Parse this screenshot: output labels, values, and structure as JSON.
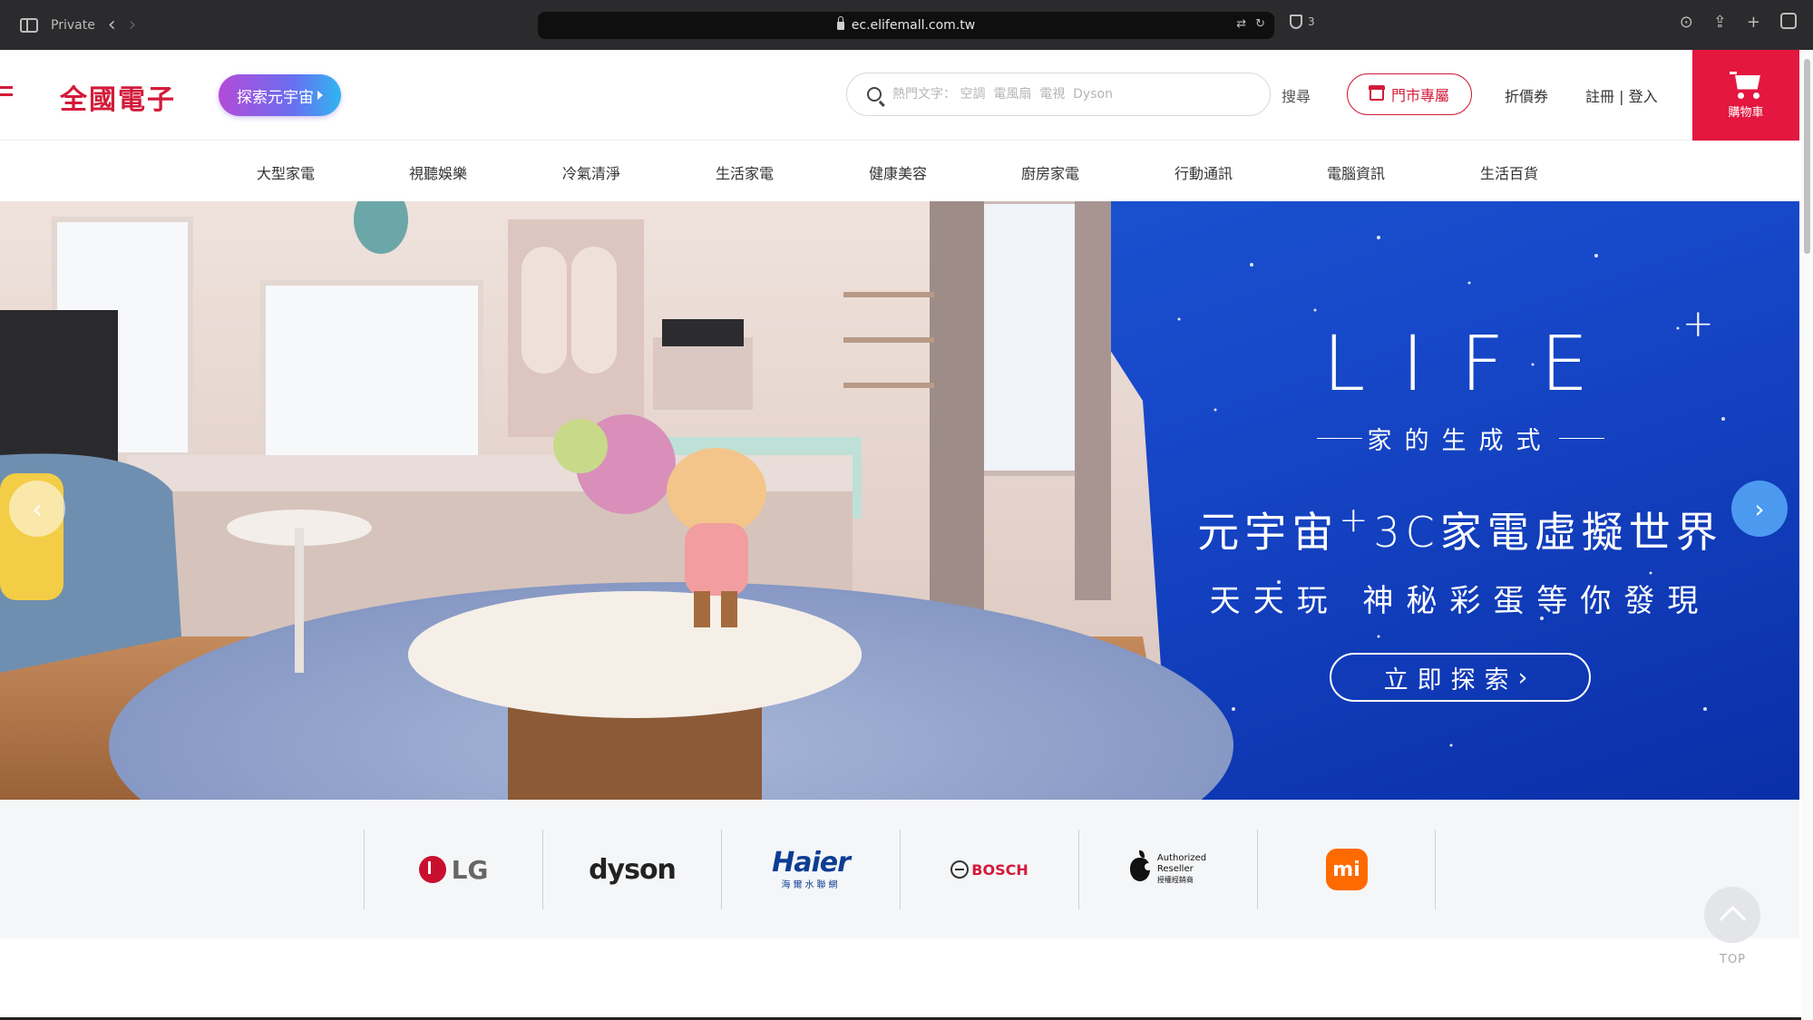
{
  "browser": {
    "mode_label": "Private",
    "url": "ec.elifemall.com.tw",
    "shield_count": "3"
  },
  "header": {
    "logo_text": "全國電子",
    "explore_label": "探索元宇宙",
    "search_placeholder": "熱門文字： 空調  電風扇  電視  Dyson",
    "search_label": "搜尋",
    "store_label": "門市專屬",
    "coupon_label": "折價券",
    "login_label": "註冊 | 登入",
    "cart_label": "購物車",
    "brand_color": "#d21b3a"
  },
  "categories": [
    "大型家電",
    "視聽娛樂",
    "冷氣清淨",
    "生活家電",
    "健康美容",
    "廚房家電",
    "行動通訊",
    "電腦資訊",
    "生活百貨"
  ],
  "hero": {
    "logo_text": "LIFE",
    "logo_sup": "+",
    "tagline": "家的生成式",
    "headline_a": "元宇宙",
    "headline_sup": "+",
    "headline_b": "3C家電虛擬世界",
    "subline": "天天玩  神秘彩蛋等你發現",
    "cta_label": "立即探索"
  },
  "brands": {
    "lg": "LG",
    "dyson": "dyson",
    "haier": "Haier",
    "haier_sub": "海爾水聯網",
    "bosch": "BOSCH",
    "apple_line1": "Authorized",
    "apple_line2": "Reseller",
    "apple_line3": "授權經銷商",
    "mi": "mi"
  },
  "top_label": "TOP"
}
